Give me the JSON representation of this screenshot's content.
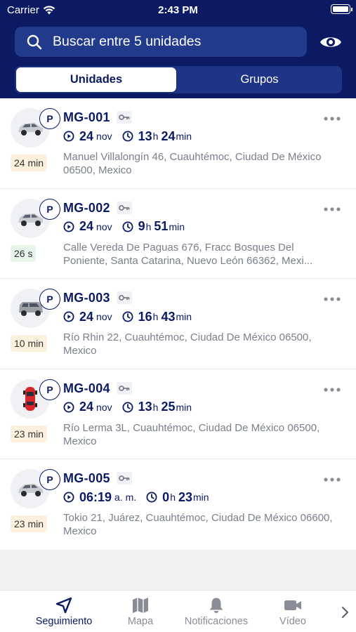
{
  "status_bar": {
    "carrier": "Carrier",
    "time": "2:43 PM"
  },
  "search": {
    "placeholder": "Buscar entre 5 unidades"
  },
  "segments": [
    {
      "label": "Unidades",
      "selected": true
    },
    {
      "label": "Grupos",
      "selected": false
    }
  ],
  "units": [
    {
      "name": "MG-001",
      "status_letter": "P",
      "vehicle": "sedan-silver",
      "elapsed": "24 min",
      "elapsed_color": "orange",
      "date_big": "24",
      "date_small": "nov",
      "dur_h": "13",
      "dur_h_unit": "h",
      "dur_m": "24",
      "dur_m_unit": "min",
      "address": "Manuel Villalongín 46, Cuauhtémoc, Ciudad De México 06500, Mexico"
    },
    {
      "name": "MG-002",
      "status_letter": "P",
      "vehicle": "sedan-silver",
      "elapsed": "26 s",
      "elapsed_color": "green",
      "date_big": "24",
      "date_small": "nov",
      "dur_h": "9",
      "dur_h_unit": "h",
      "dur_m": "51",
      "dur_m_unit": "min",
      "address": "Calle Vereda De Paguas 676, Fracc Bosques Del Poniente, Santa Catarina, Nuevo León 66362, Mexi..."
    },
    {
      "name": "MG-003",
      "status_letter": "P",
      "vehicle": "suv-gray",
      "elapsed": "10 min",
      "elapsed_color": "orange",
      "date_big": "24",
      "date_small": "nov",
      "dur_h": "16",
      "dur_h_unit": "h",
      "dur_m": "43",
      "dur_m_unit": "min",
      "address": "Río Rhin 22, Cuauhtémoc, Ciudad De México 06500, Mexico"
    },
    {
      "name": "MG-004",
      "status_letter": "P",
      "vehicle": "car-red",
      "elapsed": "23 min",
      "elapsed_color": "orange",
      "date_big": "24",
      "date_small": "nov",
      "dur_h": "13",
      "dur_h_unit": "h",
      "dur_m": "25",
      "dur_m_unit": "min",
      "address": "Río Lerma 3L, Cuauhtémoc, Ciudad De México 06500, Mexico"
    },
    {
      "name": "MG-005",
      "status_letter": "P",
      "vehicle": "sedan-silver",
      "elapsed": "23 min",
      "elapsed_color": "orange",
      "date_big": "06:19",
      "date_small": "a. m.",
      "dur_h": "0",
      "dur_h_unit": "h",
      "dur_m": "23",
      "dur_m_unit": "min",
      "address": "Tokio 21, Juárez, Cuauhtémoc, Ciudad De México 06600, Mexico"
    }
  ],
  "tabbar": [
    {
      "label": "Seguimiento",
      "icon": "navigation-arrow-icon",
      "active": true
    },
    {
      "label": "Mapa",
      "icon": "map-icon",
      "active": false
    },
    {
      "label": "Notificaciones",
      "icon": "bell-icon",
      "active": false
    },
    {
      "label": "Vídeo",
      "icon": "video-camera-icon",
      "active": false
    }
  ],
  "colors": {
    "primary": "#0c1a63",
    "search_bg": "#223a8c",
    "orange_badge": "#fdf1dd",
    "green_badge": "#e6f4ea"
  }
}
